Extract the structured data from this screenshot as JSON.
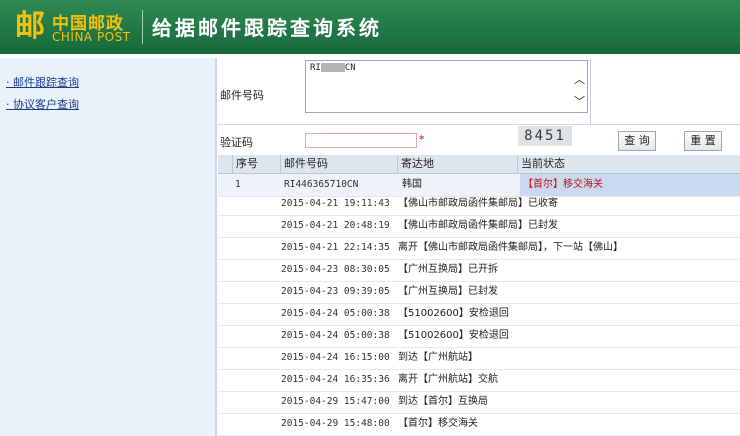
{
  "header": {
    "logo_cn": "中国邮政",
    "logo_en": "CHINA POST",
    "app_title": "给据邮件跟踪查询系统"
  },
  "sidebar": {
    "items": [
      {
        "label": "邮件跟踪查询"
      },
      {
        "label": "协议客户查询"
      }
    ]
  },
  "form": {
    "mail_no_label": "邮件号码",
    "mail_no_prefix": "RI",
    "mail_no_suffix": "CN",
    "captcha_label": "验证码",
    "captcha_required_mark": "*",
    "captcha_code": "8451",
    "query_button": "查 询",
    "reset_button": "重 置"
  },
  "table": {
    "headers": [
      "序号",
      "邮件号码",
      "寄达地",
      "当前状态"
    ],
    "summary": {
      "index": "1",
      "mail_no": "RI446365710CN",
      "destination": "韩国",
      "status": "【首尔】移交海关"
    },
    "events": [
      {
        "time": "2015-04-21 19:11:43",
        "desc": "【佛山市邮政局函件集邮局】已收寄"
      },
      {
        "time": "2015-04-21 20:48:19",
        "desc": "【佛山市邮政局函件集邮局】已封发"
      },
      {
        "time": "2015-04-21 22:14:35",
        "desc": "离开【佛山市邮政局函件集邮局】，下一站【佛山】"
      },
      {
        "time": "2015-04-23 08:30:05",
        "desc": "【广州互换局】已开拆"
      },
      {
        "time": "2015-04-23 09:39:05",
        "desc": "【广州互换局】已封发"
      },
      {
        "time": "2015-04-24 05:00:38",
        "desc": "【51002600】安检退回"
      },
      {
        "time": "2015-04-24 05:00:38",
        "desc": "【51002600】安检退回"
      },
      {
        "time": "2015-04-24 16:15:00",
        "desc": "到达【广州航站】"
      },
      {
        "time": "2015-04-24 16:35:36",
        "desc": "离开【广州航站】交航"
      },
      {
        "time": "2015-04-29 15:47:00",
        "desc": "到达【首尔】互换局"
      },
      {
        "time": "2015-04-29 15:48:00",
        "desc": "【首尔】移交海关"
      }
    ]
  },
  "colors": {
    "header_green": "#16693a",
    "logo_yellow": "#f2c20f",
    "link_blue": "#1a3e8c",
    "status_red": "#c01010"
  }
}
